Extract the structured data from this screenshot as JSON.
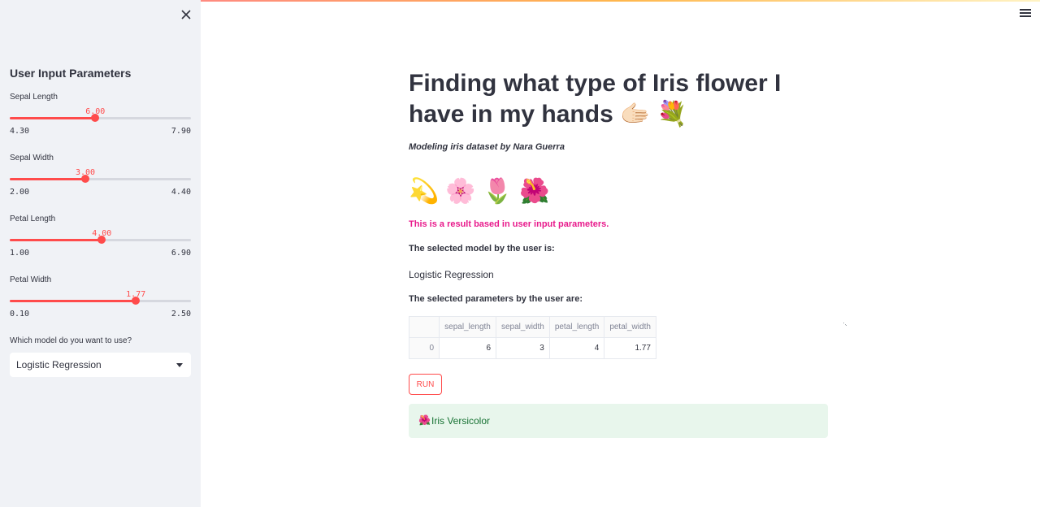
{
  "sidebar": {
    "title": "User Input Parameters",
    "sliders": [
      {
        "label": "Sepal Length",
        "value": "6.00",
        "min": "4.30",
        "max": "7.90",
        "fraction": 0.472
      },
      {
        "label": "Sepal Width",
        "value": "3.00",
        "min": "2.00",
        "max": "4.40",
        "fraction": 0.417
      },
      {
        "label": "Petal Length",
        "value": "4.00",
        "min": "1.00",
        "max": "6.90",
        "fraction": 0.508
      },
      {
        "label": "Petal Width",
        "value": "1.77",
        "min": "0.10",
        "max": "2.50",
        "fraction": 0.696
      }
    ],
    "select_label": "Which model do you want to use?",
    "select_value": "Logistic Regression"
  },
  "main": {
    "title": "Finding what type of Iris flower I have in my hands 🫱🏻 💐",
    "subtitle": "Modeling iris dataset by Nara Guerra",
    "flowers": [
      "💫",
      "🌸",
      "🌷",
      "🌺"
    ],
    "result_text": "This is a result based in user input parameters.",
    "model_label": "The selected model by the user is:",
    "model_value": "Logistic Regression",
    "params_label": "The selected parameters by the user are:",
    "table": {
      "columns": [
        "",
        "sepal_length",
        "sepal_width",
        "petal_length",
        "petal_width"
      ],
      "rows": [
        [
          "0",
          "6",
          "3",
          "4",
          "1.77"
        ]
      ]
    },
    "run_label": "RUN",
    "prediction_icon": "🌺",
    "prediction": "Iris Versicolor"
  },
  "colors": {
    "accent": "#ff4b4b",
    "sidebar_bg": "#f0f2f6",
    "result_text": "#e8198b",
    "success_bg": "#e8f6ec",
    "success_text": "#177233"
  }
}
